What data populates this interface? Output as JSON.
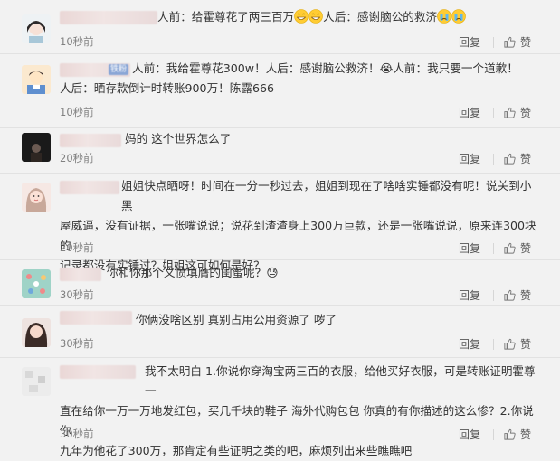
{
  "comments": [
    {
      "username": "",
      "text": "人前：给霍尊花了两三百万😁😁人后：感谢脑公的救济😭😭",
      "segments": [
        "人前：给霍尊花了两三百万",
        "😁😁",
        "人后：感谢脑公的救济",
        "😭😭"
      ],
      "time": "10秒前",
      "reply": "回复",
      "like": "赞"
    },
    {
      "username": "",
      "badge": "铁粉",
      "text_line1": "人前：我给霍尊花300w！人后：感谢脑公救济！😭人前：我只要一个道歉！",
      "text_line2": "人后：晒存款倒计时转账900万！陈露666",
      "time": "10秒前",
      "reply": "回复",
      "like": "赞"
    },
    {
      "username": "",
      "text": "妈的 这个世界怎么了",
      "time": "20秒前",
      "reply": "回复",
      "like": "赞"
    },
    {
      "username": "",
      "text_line1": "姐姐快点晒呀！时间在一分一秒过去，姐姐到现在了啥啥实锤都没有呢！说关到小黑",
      "text_line2": "屋威逼，没有证据，一张嘴说说；说花到渣渣身上300万巨款，还是一张嘴说说，原来连300块的",
      "text_line3": "记录都没有实锤过？姐姐这可如何是好？",
      "time": "20秒前",
      "reply": "回复",
      "like": "赞"
    },
    {
      "username": "",
      "text": "你和你那个义愤填膺的闺蜜呢？😓",
      "time": "30秒前",
      "reply": "回复",
      "like": "赞"
    },
    {
      "username": "",
      "text": "你俩没啥区别 真别占用公用资源了 哕了",
      "time": "30秒前",
      "reply": "回复",
      "like": "赞"
    },
    {
      "username": "",
      "text_line1": "我不太明白 1.你说你穿淘宝两三百的衣服，给他买好衣服，可是转账证明霍尊一",
      "text_line2": "直在给你一万一万地发红包，买几千块的鞋子 海外代购包包 你真的有你描述的这么惨？2.你说你",
      "text_line3": "九年为他花了300万，那肯定有些证明之类的吧，麻烦列出来些瞧瞧吧",
      "time": "30秒前",
      "reply": "回复",
      "like": "赞"
    }
  ],
  "colors": {
    "background": "#f2f2f2",
    "text": "#333333",
    "time": "#808080",
    "divider": "#e2e2e2"
  }
}
